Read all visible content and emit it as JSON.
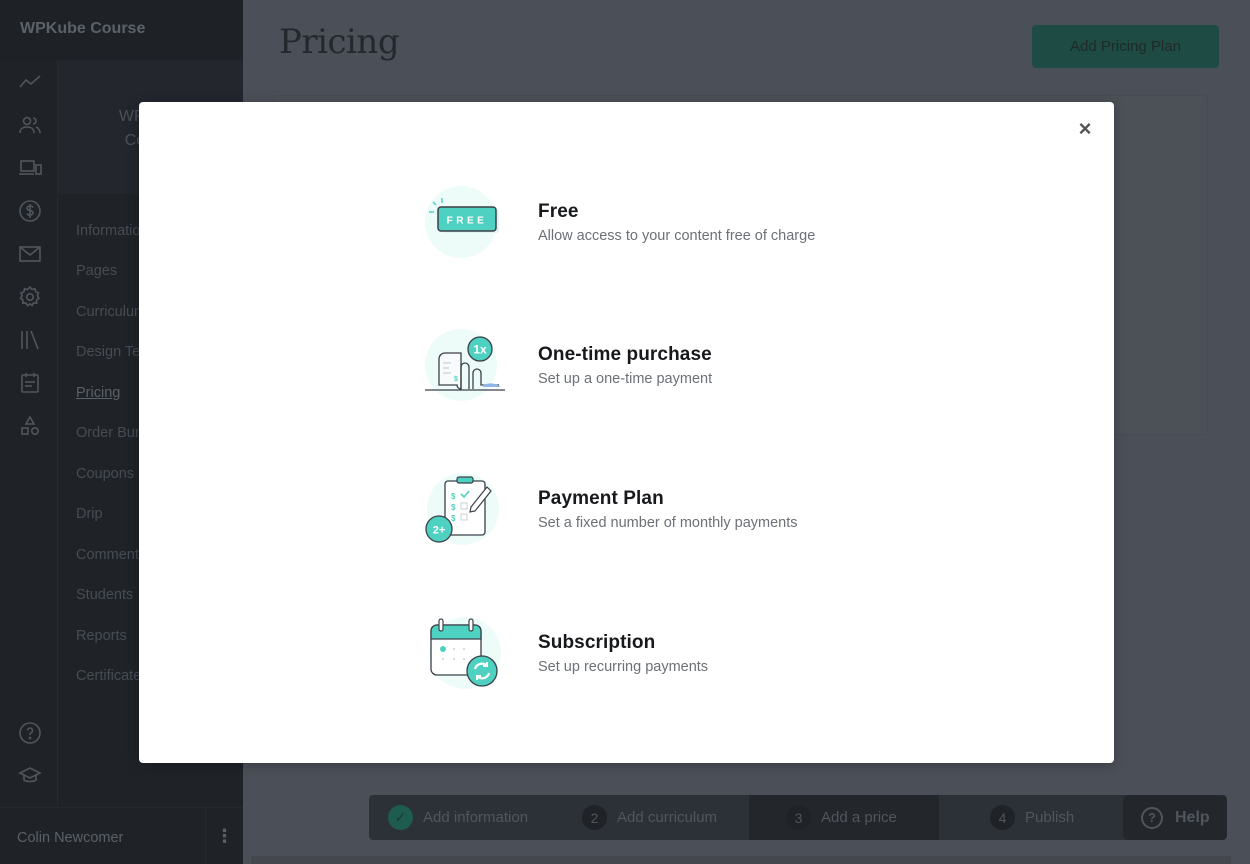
{
  "sidebar": {
    "brand": "WPKube Course",
    "course_card": [
      "WPKube",
      "Course"
    ],
    "rail_icons": [
      "analytics-icon",
      "users-icon",
      "devices-icon",
      "dollar-icon",
      "mail-icon",
      "gear-icon",
      "library-icon",
      "calendar-icon",
      "shapes-icon"
    ],
    "rail_bottom_icons": [
      "help-circle-icon",
      "graduation-cap-icon"
    ],
    "items": [
      {
        "label": "Information"
      },
      {
        "label": "Pages"
      },
      {
        "label": "Curriculum"
      },
      {
        "label": "Design Templates"
      },
      {
        "label": "Pricing",
        "active": true
      },
      {
        "label": "Order Bumps"
      },
      {
        "label": "Coupons"
      },
      {
        "label": "Drip"
      },
      {
        "label": "Comments"
      },
      {
        "label": "Students"
      },
      {
        "label": "Reports"
      },
      {
        "label": "Certificates"
      }
    ],
    "user_name": "Colin Newcomer",
    "user_menu_icon": "⋮"
  },
  "main": {
    "title": "Pricing",
    "add_button": "Add Pricing Plan"
  },
  "stepper": {
    "steps": [
      {
        "num": "✓",
        "label": "Add information",
        "state": "done"
      },
      {
        "num": "2",
        "label": "Add curriculum",
        "state": "todo"
      },
      {
        "num": "3",
        "label": "Add a price",
        "state": "current"
      },
      {
        "num": "4",
        "label": "Publish",
        "state": "todo"
      }
    ],
    "help_label": "Help",
    "help_icon": "?"
  },
  "modal": {
    "close_icon": "×",
    "options": [
      {
        "title": "Free",
        "description": "Allow access to your content free of charge",
        "icon": "free-tag-icon",
        "badge": "FREE"
      },
      {
        "title": "One-time purchase",
        "description": "Set up a one-time payment",
        "icon": "receipt-icon",
        "badge": "1x"
      },
      {
        "title": "Payment Plan",
        "description": "Set a fixed number of monthly payments",
        "icon": "clipboard-icon",
        "badge": "2+"
      },
      {
        "title": "Subscription",
        "description": "Set up recurring payments",
        "icon": "calendar-refresh-icon"
      }
    ]
  },
  "colors": {
    "accent": "#4fd1c1",
    "overlay_bg": "#4b5058",
    "sidebar_bg": "#1f2328"
  }
}
